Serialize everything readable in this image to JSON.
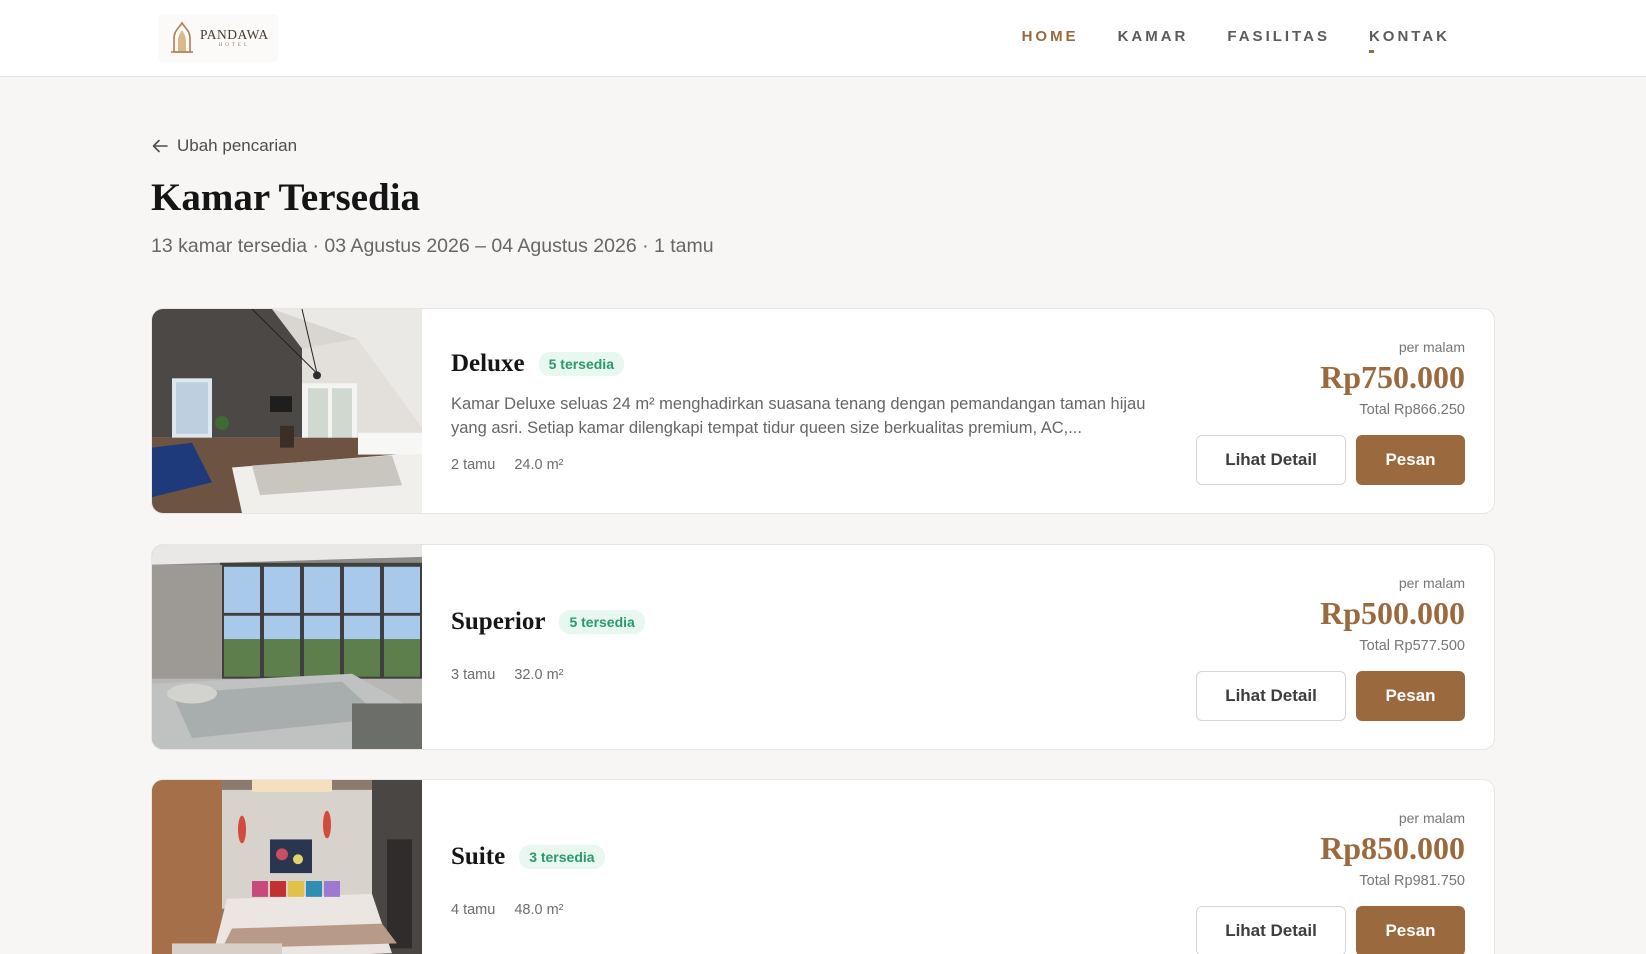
{
  "brand": {
    "name": "PANDAWA",
    "sub": "HOTEL",
    "accent_color": "#9a6a3e"
  },
  "nav": {
    "items": [
      "HOME",
      "KAMAR",
      "FASILITAS",
      "KONTAK"
    ],
    "active": "HOME"
  },
  "search": {
    "back_label": "Ubah pencarian",
    "title": "Kamar Tersedia",
    "summary": "13 kamar tersedia · 03 Agustus 2026 – 04 Agustus 2026 · 1 tamu"
  },
  "rooms": [
    {
      "name": "Deluxe",
      "availability": "5 tersedia",
      "description": "Kamar Deluxe seluas 24 m² menghadirkan suasana tenang dengan pemandangan taman hijau yang asri. Setiap kamar dilengkapi tempat tidur queen size berkualitas premium, AC,...",
      "guests": "2 tamu",
      "size": "24.0 m²",
      "per_night_label": "per malam",
      "price": "Rp750.000",
      "total": "Total Rp866.250",
      "detail_label": "Lihat Detail",
      "book_label": "Pesan",
      "photo": "attic-bedroom-photo"
    },
    {
      "name": "Superior",
      "availability": "5 tersedia",
      "description": "",
      "guests": "3 tamu",
      "size": "32.0 m²",
      "per_night_label": "per malam",
      "price": "Rp500.000",
      "total": "Total Rp577.500",
      "detail_label": "Lihat Detail",
      "book_label": "Pesan",
      "photo": "panoramic-window-bedroom-photo"
    },
    {
      "name": "Suite",
      "availability": "3 tersedia",
      "description": "",
      "guests": "4 tamu",
      "size": "48.0 m²",
      "per_night_label": "per malam",
      "price": "Rp850.000",
      "total": "Total Rp981.750",
      "detail_label": "Lihat Detail",
      "book_label": "Pesan",
      "photo": "suite-bedroom-photo"
    }
  ]
}
